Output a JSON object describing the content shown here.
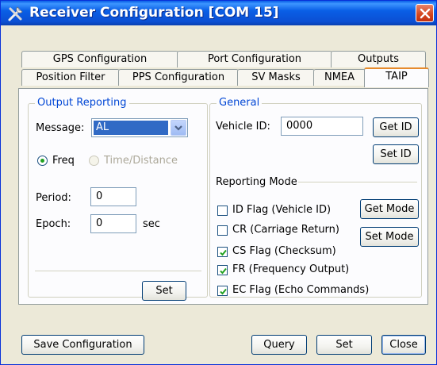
{
  "window": {
    "title": "Receiver Configuration [COM 15]"
  },
  "tabs_row1": [
    "GPS Configuration",
    "Port Configuration",
    "Outputs"
  ],
  "tabs_row2": [
    "Position Filter",
    "PPS Configuration",
    "SV Masks",
    "NMEA",
    "TAIP"
  ],
  "active_tab": "TAIP",
  "output_reporting": {
    "title": "Output Reporting",
    "message_label": "Message:",
    "message_value": "AL",
    "freq_label": "Freq",
    "time_distance_label": "Time/Distance",
    "period_label": "Period:",
    "period_value": "0",
    "epoch_label": "Epoch:",
    "epoch_value": "0",
    "epoch_unit": "sec",
    "set_label": "Set"
  },
  "general": {
    "title": "General",
    "vehicle_id_label": "Vehicle ID:",
    "vehicle_id_value": "0000",
    "get_id_label": "Get ID",
    "set_id_label": "Set ID"
  },
  "reporting_mode": {
    "title": "Reporting Mode",
    "flags": [
      {
        "label": "ID Flag (Vehicle ID)",
        "checked": false
      },
      {
        "label": "CR (Carriage Return)",
        "checked": false
      },
      {
        "label": "CS Flag (Checksum)",
        "checked": true
      },
      {
        "label": "FR (Frequency Output)",
        "checked": true
      },
      {
        "label": "EC Flag (Echo Commands)",
        "checked": true
      }
    ],
    "get_mode_label": "Get Mode",
    "set_mode_label": "Set Mode"
  },
  "footer": {
    "save_label": "Save Configuration",
    "query_label": "Query",
    "set_label": "Set",
    "close_label": "Close"
  }
}
